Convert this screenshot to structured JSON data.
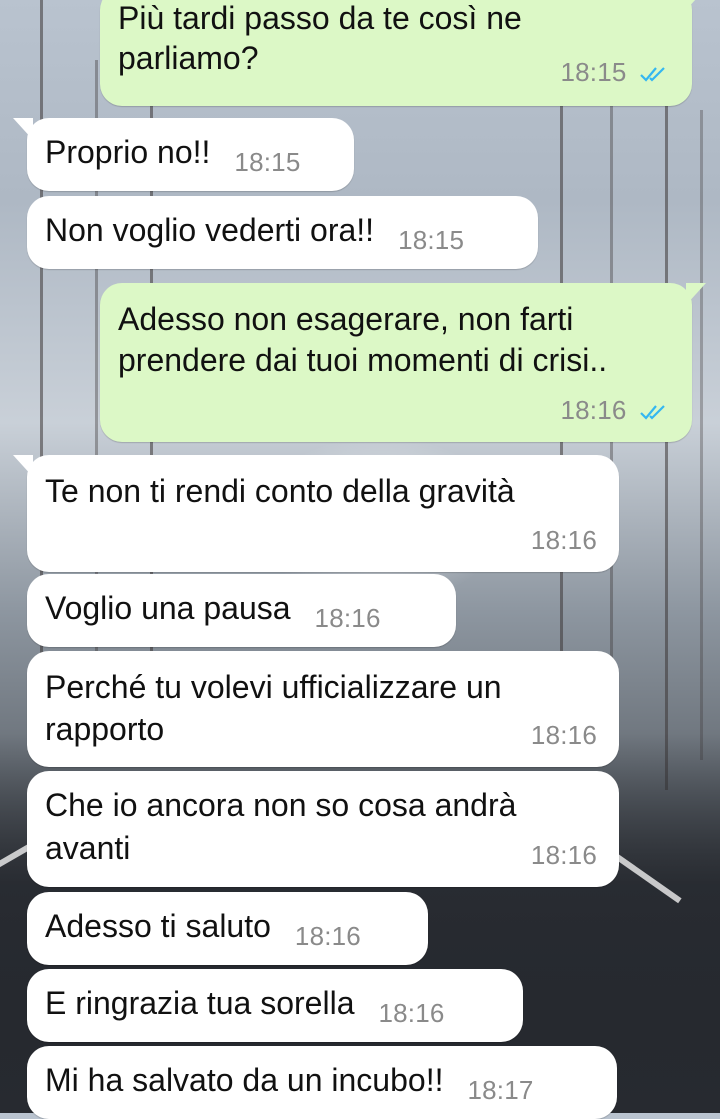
{
  "colors": {
    "incoming_bubble": "#ffffff",
    "outgoing_bubble": "#dcf8c6",
    "text": "#111111",
    "timestamp": "#8a8a8a",
    "read_ticks": "#34b7f1"
  },
  "messages": [
    {
      "direction": "outgoing",
      "text": "Più tardi passo da te così ne parliamo?",
      "line1": "Più tardi passo da te così ne",
      "line2": "parliamo?",
      "time": "18:15",
      "status_icon": "double-check-read-icon"
    },
    {
      "direction": "incoming",
      "text": "Proprio no!!",
      "time": "18:15"
    },
    {
      "direction": "incoming",
      "text": "Non voglio vederti ora!!",
      "time": "18:15"
    },
    {
      "direction": "outgoing",
      "text": "Adesso non esagerare, non farti prendere dai tuoi momenti di crisi..",
      "line1": "Adesso non esagerare, non farti",
      "line2": "prendere dai tuoi momenti di crisi..",
      "time": "18:16",
      "status_icon": "double-check-read-icon"
    },
    {
      "direction": "incoming",
      "text": "Te non ti rendi conto della gravità",
      "time": "18:16"
    },
    {
      "direction": "incoming",
      "text": "Voglio una pausa",
      "time": "18:16"
    },
    {
      "direction": "incoming",
      "text": "Perché tu volevi ufficializzare un rapporto",
      "line1": "Perché tu volevi ufficializzare un",
      "line2": "rapporto",
      "time": "18:16"
    },
    {
      "direction": "incoming",
      "text": "Che io ancora non so cosa andrà avanti",
      "line1": "Che io ancora non so cosa andrà",
      "line2": "avanti",
      "time": "18:16"
    },
    {
      "direction": "incoming",
      "text": "Adesso ti saluto",
      "time": "18:16"
    },
    {
      "direction": "incoming",
      "text": "E ringrazia tua sorella",
      "time": "18:16"
    },
    {
      "direction": "incoming",
      "text": "Mi ha salvato da un incubo!!",
      "time": "18:17"
    }
  ]
}
